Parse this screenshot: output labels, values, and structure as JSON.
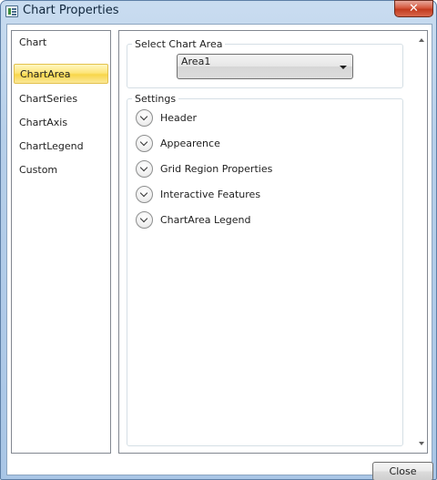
{
  "window": {
    "title": "Chart Properties",
    "close_glyph": "✕"
  },
  "sidebar": {
    "items": [
      {
        "label": "Chart"
      },
      {
        "label": "ChartArea",
        "selected": true
      },
      {
        "label": "ChartSeries"
      },
      {
        "label": "ChartAxis"
      },
      {
        "label": "ChartLegend"
      },
      {
        "label": "Custom"
      }
    ]
  },
  "chart_area": {
    "group_label": "Select Chart Area",
    "selected_value": "Area1"
  },
  "settings": {
    "group_label": "Settings",
    "items": [
      {
        "label": "Header"
      },
      {
        "label": "Appearence"
      },
      {
        "label": "Grid Region Properties"
      },
      {
        "label": "Interactive Features"
      },
      {
        "label": "ChartArea Legend"
      }
    ]
  },
  "footer": {
    "close_label": "Close"
  },
  "colors": {
    "selected_item": "#fde57a",
    "close_caption": "#c23b1f"
  },
  "icons": {
    "app": "chart-window-icon",
    "expand": "chevron-down-icon",
    "scroll_up": "scroll-up-arrow",
    "scroll_down": "scroll-down-arrow",
    "dropdown": "dropdown-arrow"
  }
}
